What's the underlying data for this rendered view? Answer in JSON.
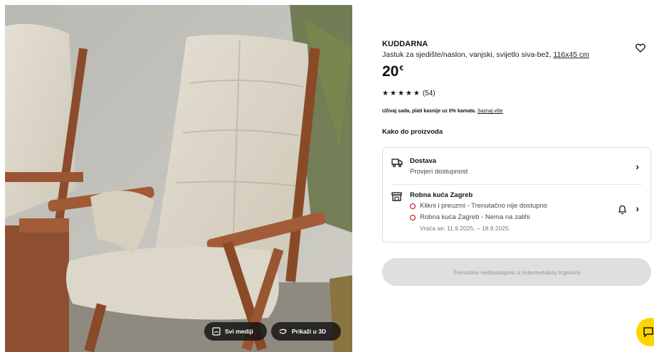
{
  "media": {
    "all_media_label": "Svi mediji",
    "view_3d_label": "Prikaži u 3D"
  },
  "product": {
    "name": "KUDDARNA",
    "description": "Jastuk za sjedište/naslon, vanjski, svijetlo siva-bež,",
    "size": "116x45 cm",
    "price": "20",
    "currency": "€",
    "rating_stars": 4.5,
    "review_count": "(54)",
    "promo_text": "Uživaj sada, plati kasnije uz 0% kamata.",
    "promo_link": "Saznaj više"
  },
  "availability": {
    "heading": "Kako do proizvoda",
    "delivery": {
      "title": "Dostava",
      "subtitle": "Provjeri dostupnost"
    },
    "store": {
      "title": "Robna kuća Zagreb",
      "click_collect": "Klikni i preuzmi - Trenutačno nije dostupno",
      "stock": "Robna kuća Zagreb - Nema na zalihi",
      "return": "Vraća se: 11.9.2025. – 18.9.2025."
    }
  },
  "cta_label": "Trenutno nedostupno u internetskoj trgovini",
  "colors": {
    "unavailable": "#cc0008",
    "chat_bg": "#ffd500",
    "cta_bg": "#dfdfdf"
  }
}
